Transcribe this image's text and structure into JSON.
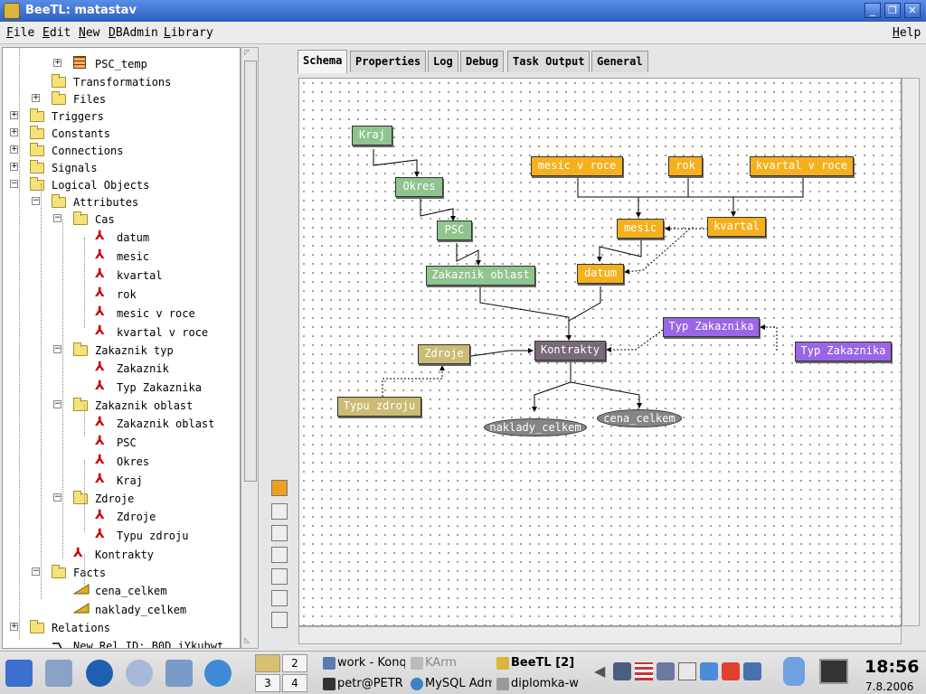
{
  "window": {
    "title": "BeeTL: matastav"
  },
  "menu": {
    "items": [
      "File",
      "Edit",
      "New",
      "DBAdmin",
      "Library"
    ],
    "help": "Help"
  },
  "tree": {
    "items": [
      {
        "label": "PSC_temp",
        "icon": "table-icon",
        "expander": "+"
      },
      {
        "label": "Transformations",
        "icon": "folder-icon",
        "expander": ""
      },
      {
        "label": "Files",
        "icon": "folder-icon",
        "expander": "+"
      },
      {
        "label": "Triggers",
        "icon": "folder-icon",
        "expander": "+"
      },
      {
        "label": "Constants",
        "icon": "folder-icon",
        "expander": "+"
      },
      {
        "label": "Connections",
        "icon": "folder-icon",
        "expander": "+"
      },
      {
        "label": "Signals",
        "icon": "folder-icon",
        "expander": "+"
      },
      {
        "label": "Logical Objects",
        "icon": "folder-icon",
        "expander": "−"
      },
      {
        "label": "Attributes",
        "icon": "folder-icon",
        "expander": "−"
      },
      {
        "label": "Cas",
        "icon": "folder-icon",
        "expander": "−"
      },
      {
        "label": "datum",
        "icon": "attribute-icon",
        "expander": ""
      },
      {
        "label": "mesic",
        "icon": "attribute-icon",
        "expander": ""
      },
      {
        "label": "kvartal",
        "icon": "attribute-icon",
        "expander": ""
      },
      {
        "label": "rok",
        "icon": "attribute-icon",
        "expander": ""
      },
      {
        "label": "mesic v roce",
        "icon": "attribute-icon",
        "expander": ""
      },
      {
        "label": "kvartal v roce",
        "icon": "attribute-icon",
        "expander": ""
      },
      {
        "label": "Zakaznik typ",
        "icon": "folder-icon",
        "expander": "−"
      },
      {
        "label": "Zakaznik",
        "icon": "attribute-icon",
        "expander": ""
      },
      {
        "label": "Typ Zakaznika",
        "icon": "attribute-icon",
        "expander": ""
      },
      {
        "label": "Zakaznik oblast",
        "icon": "folder-icon",
        "expander": "−"
      },
      {
        "label": "Zakaznik oblast",
        "icon": "attribute-icon",
        "expander": ""
      },
      {
        "label": "PSC",
        "icon": "attribute-icon",
        "expander": ""
      },
      {
        "label": "Okres",
        "icon": "attribute-icon",
        "expander": ""
      },
      {
        "label": "Kraj",
        "icon": "attribute-icon",
        "expander": ""
      },
      {
        "label": "Zdroje",
        "icon": "folder-icon",
        "expander": "−"
      },
      {
        "label": "Zdroje",
        "icon": "attribute-icon",
        "expander": ""
      },
      {
        "label": "Typu zdroju",
        "icon": "attribute-icon",
        "expander": ""
      },
      {
        "label": "Kontrakty",
        "icon": "attribute-icon",
        "expander": ""
      },
      {
        "label": "Facts",
        "icon": "folder-icon",
        "expander": "−"
      },
      {
        "label": "cena_celkem",
        "icon": "fact-icon",
        "expander": ""
      },
      {
        "label": "naklady_celkem",
        "icon": "fact-icon",
        "expander": ""
      },
      {
        "label": "Relations",
        "icon": "folder-icon",
        "expander": "+"
      },
      {
        "label": "New Rel ID: B0D.iYkubwt",
        "icon": "relation-icon",
        "expander": ""
      }
    ]
  },
  "tabs": [
    "Schema",
    "Properties",
    "Log",
    "Debug",
    "Task Output",
    "General"
  ],
  "schema": {
    "nodes": {
      "kraj": "Kraj",
      "okres": "Okres",
      "psc": "PSC",
      "zakaznik_oblast": "Zakaznik oblast",
      "mesic_v_roce": "mesic v roce",
      "rok": "rok",
      "kvartal_v_roce": "kvartal v roce",
      "mesic": "mesic",
      "kvartal": "kvartal",
      "datum": "datum",
      "typ_zakaznika_1": "Typ Zakaznika",
      "typ_zakaznika_2": "Typ Zakaznika",
      "zdroje": "Zdroje",
      "kontrakty": "Kontrakty",
      "typu_zdroju": "Typu zdroju",
      "naklady_celkem": "naklady_celkem",
      "cena_celkem": "cena_celkem"
    }
  },
  "taskbar": {
    "pager": [
      "2",
      "3",
      "4"
    ],
    "tasks": [
      "work - Konq",
      "KArm",
      "BeeTL [2]",
      "petr@PETR",
      "MySQL Adm",
      "diplomka-w"
    ],
    "clock": {
      "time": "18:56",
      "date": "7.8.2006"
    }
  },
  "colors": {
    "green": "#8fc48f",
    "orange": "#f5b01e",
    "purple": "#9a66e6",
    "olive": "#cbbb74",
    "dark": "#786a78"
  }
}
